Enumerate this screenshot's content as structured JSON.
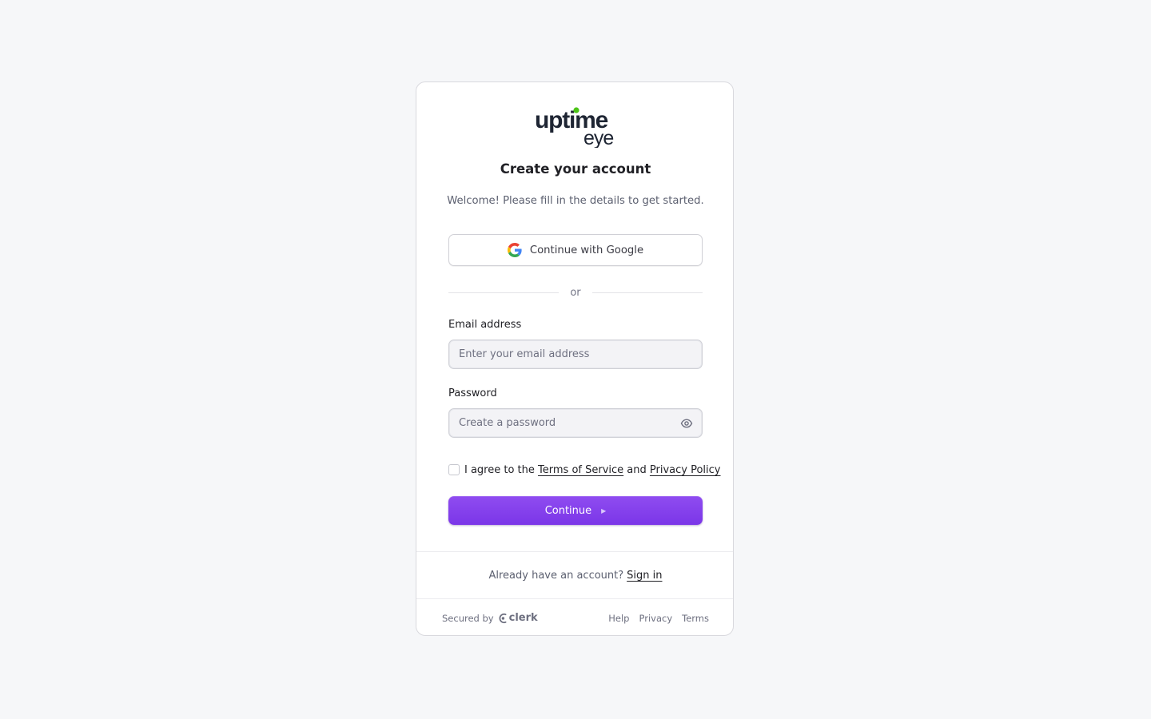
{
  "brand": {
    "logo_line1": "uptime",
    "logo_line2": "eye",
    "logo_dot_color": "#4cc417",
    "accent_color": "#7c3aed"
  },
  "header": {
    "title": "Create your account",
    "subtitle": "Welcome! Please fill in the details to get started."
  },
  "social": {
    "google_label": "Continue with Google",
    "google_icon": "google-g-icon"
  },
  "divider": {
    "label": "or"
  },
  "form": {
    "email_label": "Email address",
    "email_placeholder": "Enter your email address",
    "email_value": "",
    "password_label": "Password",
    "password_placeholder": "Create a password",
    "password_value": "",
    "password_toggle_icon": "eye-icon",
    "agree_checked": false,
    "agree_prefix": "I agree to the",
    "terms_link": "Terms of Service",
    "agree_and": "and",
    "privacy_link": "Privacy Policy",
    "continue_label": "Continue",
    "continue_icon": "triangle-right-icon"
  },
  "signin": {
    "prompt": "Already have an account?",
    "link": "Sign in"
  },
  "footer": {
    "secured_by": "Secured by",
    "provider": "clerk",
    "links": [
      "Help",
      "Privacy",
      "Terms"
    ]
  }
}
